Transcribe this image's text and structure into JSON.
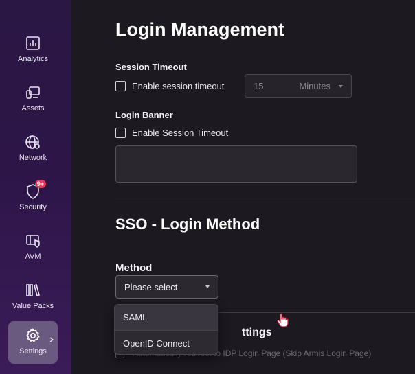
{
  "sidebar": {
    "items": [
      {
        "label": "Analytics",
        "icon": "analytics-icon"
      },
      {
        "label": "Assets",
        "icon": "assets-icon"
      },
      {
        "label": "Network",
        "icon": "network-icon"
      },
      {
        "label": "Security",
        "icon": "security-icon",
        "badge": "9+"
      },
      {
        "label": "AVM",
        "icon": "avm-icon"
      },
      {
        "label": "Value Packs",
        "icon": "value-packs-icon"
      },
      {
        "label": "Settings",
        "icon": "gear-icon",
        "active": true
      }
    ]
  },
  "page": {
    "title": "Login Management"
  },
  "session_timeout": {
    "label": "Session Timeout",
    "checkbox_label": "Enable session timeout",
    "checked": false,
    "value": "15",
    "unit": "Minutes"
  },
  "login_banner": {
    "label": "Login Banner",
    "checkbox_label": "Enable Session Timeout",
    "checked": false,
    "text": ""
  },
  "sso": {
    "title": "SSO - Login Method",
    "method_label": "Method",
    "method_value": "Please select",
    "options": [
      "SAML",
      "OpenID Connect"
    ],
    "settings_title_partial": "ttings",
    "redirect_label": "Automatically redirect to IDP Login Page (Skip Armis Login Page)"
  },
  "colors": {
    "sidebar_bg": "#2a1743",
    "active_nav": "#6a5a80",
    "badge": "#e23b5c",
    "content_bg": "#1c1a20"
  }
}
